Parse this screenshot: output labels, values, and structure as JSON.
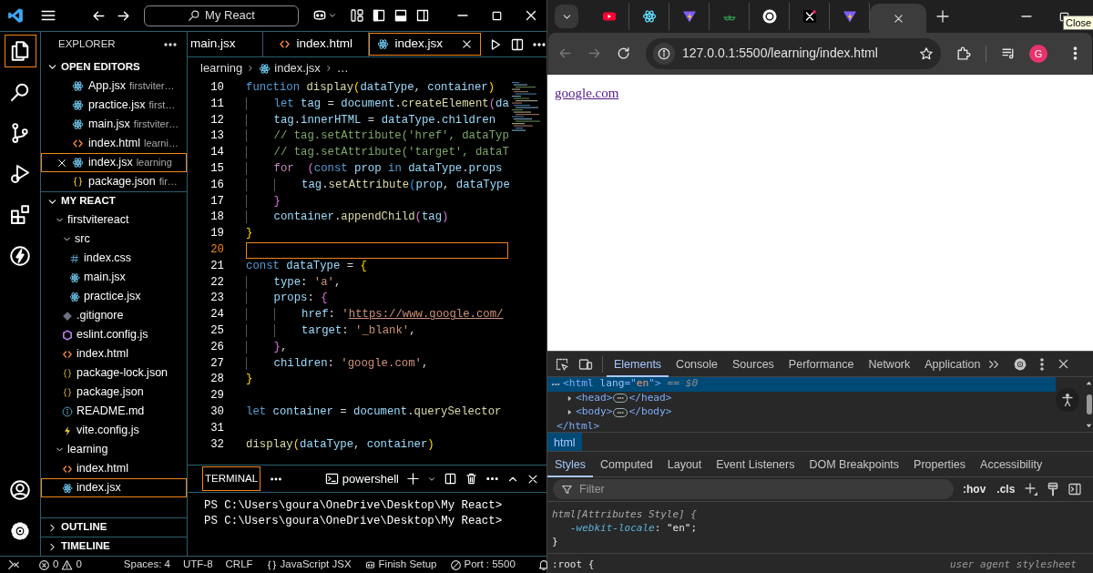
{
  "vscode": {
    "search": "My React",
    "activity": [
      {
        "kind": "explorer",
        "selected": true
      },
      {
        "kind": "search",
        "selected": false
      },
      {
        "kind": "source-control",
        "selected": false
      },
      {
        "kind": "run",
        "selected": false
      },
      {
        "kind": "extensions",
        "selected": false
      },
      {
        "kind": "lightning",
        "selected": false
      }
    ],
    "activity_bottom": [
      {
        "kind": "account"
      },
      {
        "kind": "settings"
      }
    ],
    "sidebar": {
      "title": "EXPLORER",
      "open_editors": {
        "title": "OPEN EDITORS",
        "expanded": true,
        "items": [
          {
            "kind": "react",
            "name": "App.jsx",
            "folder": "firstviter…",
            "selected": false
          },
          {
            "kind": "react",
            "name": "practice.jsx",
            "folder": "first…",
            "selected": false
          },
          {
            "kind": "react",
            "name": "main.jsx",
            "folder": "firstviter…",
            "selected": false
          },
          {
            "kind": "html",
            "name": "index.html",
            "folder": "learni…",
            "selected": false
          },
          {
            "kind": "react",
            "name": "index.jsx",
            "folder": "learning",
            "selected": true
          },
          {
            "kind": "json",
            "name": "package.json",
            "folder": "fir…",
            "selected": false
          }
        ]
      },
      "folder": {
        "title": "MY REACT",
        "expanded": true,
        "tree": [
          {
            "kind": "folder",
            "label": "firstvitereact",
            "expanded": true,
            "selected": false,
            "children": [
              {
                "kind": "folder",
                "label": "src",
                "expanded": true,
                "selected": false,
                "children": [
                  {
                    "kind": "css",
                    "label": "index.css",
                    "selected": false
                  },
                  {
                    "kind": "react",
                    "label": "main.jsx",
                    "selected": false
                  },
                  {
                    "kind": "react",
                    "label": "practice.jsx",
                    "selected": false
                  }
                ]
              },
              {
                "kind": "git",
                "label": ".gitignore",
                "selected": false
              },
              {
                "kind": "eslint",
                "label": "eslint.config.js",
                "selected": false
              },
              {
                "kind": "html",
                "label": "index.html",
                "selected": false
              },
              {
                "kind": "json",
                "label": "package-lock.json",
                "selected": false
              },
              {
                "kind": "json",
                "label": "package.json",
                "selected": false
              },
              {
                "kind": "info",
                "label": "README.md",
                "selected": false
              },
              {
                "kind": "vite",
                "label": "vite.config.js",
                "selected": false
              }
            ]
          },
          {
            "kind": "folder",
            "label": "learning",
            "expanded": true,
            "selected": false,
            "children": [
              {
                "kind": "html",
                "label": "index.html",
                "selected": false
              },
              {
                "kind": "react",
                "label": "index.jsx",
                "selected": true
              }
            ]
          }
        ]
      },
      "outline": {
        "title": "OUTLINE",
        "expanded": false
      },
      "timeline": {
        "title": "TIMELINE",
        "expanded": false
      }
    },
    "tabs": [
      {
        "label": "main.jsx",
        "selected": false
      },
      {
        "label": "index.html",
        "kind": "html",
        "selected": false
      },
      {
        "label": "index.jsx",
        "kind": "react",
        "selected": true
      }
    ],
    "breadcrumb": [
      {
        "label": "learning"
      },
      {
        "label": "index.jsx",
        "kind": "react"
      },
      {
        "label": "…"
      }
    ],
    "code": [
      {
        "number": "10",
        "current": false,
        "tokens": [
          {
            "kind": "kw",
            "text": "function"
          },
          {
            "kind": "fn",
            "text": " display"
          },
          {
            "kind": "b1",
            "text": "("
          },
          {
            "kind": "var",
            "text": "dataType"
          },
          {
            "kind": "op",
            "text": ", "
          },
          {
            "kind": "var",
            "text": "container"
          },
          {
            "kind": "b1",
            "text": ")"
          }
        ]
      },
      {
        "number": "11",
        "current": false,
        "tokens": [
          {
            "kind": "kw",
            "text": "    let"
          },
          {
            "kind": "var",
            "text": " tag"
          },
          {
            "kind": "op",
            "text": " = "
          },
          {
            "kind": "var",
            "text": "document"
          },
          {
            "kind": "op",
            "text": "."
          },
          {
            "kind": "fn",
            "text": "createElement"
          },
          {
            "kind": "b2",
            "text": "("
          },
          {
            "kind": "var",
            "text": "da"
          }
        ]
      },
      {
        "number": "12",
        "current": false,
        "tokens": [
          {
            "kind": "var",
            "text": "    tag"
          },
          {
            "kind": "op",
            "text": "."
          },
          {
            "kind": "var",
            "text": "innerHTML"
          },
          {
            "kind": "op",
            "text": " = "
          },
          {
            "kind": "var",
            "text": "dataType"
          },
          {
            "kind": "op",
            "text": "."
          },
          {
            "kind": "var",
            "text": "children"
          }
        ]
      },
      {
        "number": "13",
        "current": false,
        "tokens": [
          {
            "kind": "cm",
            "text": "    // tag.setAttribute('href', dataTyp"
          }
        ]
      },
      {
        "number": "14",
        "current": false,
        "tokens": [
          {
            "kind": "cm",
            "text": "    // tag.setAttribute('target', dataT"
          }
        ]
      },
      {
        "number": "15",
        "current": false,
        "tokens": [
          {
            "kind": "ctl",
            "text": "    for"
          },
          {
            "kind": "b2",
            "text": "  ("
          },
          {
            "kind": "kw",
            "text": "const"
          },
          {
            "kind": "var",
            "text": " prop "
          },
          {
            "kind": "kw",
            "text": "in"
          },
          {
            "kind": "var",
            "text": " dataType"
          },
          {
            "kind": "op",
            "text": "."
          },
          {
            "kind": "var",
            "text": "props"
          }
        ]
      },
      {
        "number": "16",
        "current": false,
        "tokens": [
          {
            "kind": "var",
            "text": "        tag"
          },
          {
            "kind": "op",
            "text": "."
          },
          {
            "kind": "fn",
            "text": "setAttribute"
          },
          {
            "kind": "b3",
            "text": "("
          },
          {
            "kind": "var",
            "text": "prop"
          },
          {
            "kind": "op",
            "text": ", "
          },
          {
            "kind": "var",
            "text": "dataType"
          }
        ]
      },
      {
        "number": "17",
        "current": false,
        "tokens": [
          {
            "kind": "b2",
            "text": "    }"
          }
        ]
      },
      {
        "number": "18",
        "current": false,
        "tokens": [
          {
            "kind": "var",
            "text": "    container"
          },
          {
            "kind": "op",
            "text": "."
          },
          {
            "kind": "fn",
            "text": "appendChild"
          },
          {
            "kind": "b2",
            "text": "("
          },
          {
            "kind": "var",
            "text": "tag"
          },
          {
            "kind": "b2",
            "text": ")"
          }
        ]
      },
      {
        "number": "19",
        "current": false,
        "tokens": [
          {
            "kind": "b1",
            "text": "}"
          }
        ]
      },
      {
        "number": "20",
        "current": true
      },
      {
        "number": "21",
        "current": false,
        "tokens": [
          {
            "kind": "kw",
            "text": "const"
          },
          {
            "kind": "var",
            "text": " dataType"
          },
          {
            "kind": "op",
            "text": " = "
          },
          {
            "kind": "b1",
            "text": "{"
          }
        ]
      },
      {
        "number": "22",
        "current": false,
        "tokens": [
          {
            "kind": "var",
            "text": "    type"
          },
          {
            "kind": "op",
            "text": ": "
          },
          {
            "kind": "str",
            "text": "'a'"
          },
          {
            "kind": "op",
            "text": ","
          }
        ]
      },
      {
        "number": "23",
        "current": false,
        "tokens": [
          {
            "kind": "var",
            "text": "    props"
          },
          {
            "kind": "op",
            "text": ": "
          },
          {
            "kind": "b2",
            "text": "{"
          }
        ]
      },
      {
        "number": "24",
        "current": false,
        "tokens": [
          {
            "kind": "var",
            "text": "        href"
          },
          {
            "kind": "op",
            "text": ": "
          },
          {
            "kind": "str",
            "text": "'"
          },
          {
            "kind": "url",
            "text": "https://www.google.com/"
          }
        ]
      },
      {
        "number": "25",
        "current": false,
        "tokens": [
          {
            "kind": "var",
            "text": "        target"
          },
          {
            "kind": "op",
            "text": ": "
          },
          {
            "kind": "str",
            "text": "'_blank'"
          },
          {
            "kind": "op",
            "text": ","
          }
        ]
      },
      {
        "number": "26",
        "current": false,
        "tokens": [
          {
            "kind": "b2",
            "text": "    }"
          },
          {
            "kind": "op",
            "text": ","
          }
        ]
      },
      {
        "number": "27",
        "current": false,
        "tokens": [
          {
            "kind": "var",
            "text": "    children"
          },
          {
            "kind": "op",
            "text": ": "
          },
          {
            "kind": "str",
            "text": "'google.com'"
          },
          {
            "kind": "op",
            "text": ","
          }
        ]
      },
      {
        "number": "28",
        "current": false,
        "tokens": [
          {
            "kind": "b1",
            "text": "}"
          }
        ]
      },
      {
        "number": "29",
        "current": false
      },
      {
        "number": "30",
        "current": false,
        "tokens": [
          {
            "kind": "kw",
            "text": "let"
          },
          {
            "kind": "var",
            "text": " container"
          },
          {
            "kind": "op",
            "text": " = "
          },
          {
            "kind": "var",
            "text": "document"
          },
          {
            "kind": "op",
            "text": "."
          },
          {
            "kind": "fn",
            "text": "querySelector"
          }
        ]
      },
      {
        "number": "31",
        "current": false
      },
      {
        "number": "32",
        "current": false,
        "tokens": [
          {
            "kind": "fn",
            "text": "display"
          },
          {
            "kind": "b1",
            "text": "("
          },
          {
            "kind": "var",
            "text": "dataType"
          },
          {
            "kind": "op",
            "text": ", "
          },
          {
            "kind": "var",
            "text": "container"
          },
          {
            "kind": "b1",
            "text": ")"
          }
        ]
      }
    ],
    "terminal": {
      "tabs": [
        {
          "label": "TERMINAL",
          "selected": true
        }
      ],
      "shell": "powershell",
      "lines": [
        "PS C:\\Users\\goura\\OneDrive\\Desktop\\My React>",
        "PS C:\\Users\\goura\\OneDrive\\Desktop\\My React>"
      ]
    },
    "status": {
      "errors": "0",
      "warnings": "0",
      "items": [
        "Spaces: 4",
        "UTF-8",
        "CRLF"
      ],
      "language": "JavaScript JSX",
      "setup": "Finish Setup",
      "port": "Port : 5500"
    }
  },
  "browser": {
    "tabs": [
      {
        "kind": "youtube",
        "selected": false
      },
      {
        "kind": "react",
        "selected": false
      },
      {
        "kind": "vite",
        "selected": false
      },
      {
        "kind": "gfg",
        "selected": false
      },
      {
        "kind": "openai",
        "selected": false
      },
      {
        "kind": "x",
        "selected": false
      },
      {
        "kind": "vite",
        "selected": false
      },
      {
        "kind": "blank",
        "selected": true
      }
    ],
    "tooltip": "Close",
    "back_enabled": false,
    "forward_enabled": false,
    "url": "127.0.0.1:5500/learning/index.html",
    "profile": "G",
    "page": {
      "link": "google.com"
    },
    "devtools": {
      "tabs": [
        {
          "label": "Elements",
          "selected": true
        },
        {
          "label": "Console",
          "selected": false
        },
        {
          "label": "Sources",
          "selected": false
        },
        {
          "label": "Performance",
          "selected": false
        },
        {
          "label": "Network",
          "selected": false
        },
        {
          "label": "Application",
          "selected": false
        }
      ],
      "dom": [
        {
          "selected": true,
          "expandable": false,
          "tokens": [
            {
              "kind": "tag",
              "text": "<html"
            },
            {
              "kind": "attr",
              "text": " lang"
            },
            {
              "kind": "tag",
              "text": "=\""
            },
            {
              "kind": "val",
              "text": "en"
            },
            {
              "kind": "tag",
              "text": "\">"
            },
            {
              "kind": "ref",
              "text": " == $0"
            }
          ]
        },
        {
          "selected": false,
          "expandable": true,
          "tokens": [
            {
              "kind": "tag",
              "text": "<head>"
            },
            {
              "kind": "collapsed"
            },
            {
              "kind": "tag",
              "text": "</head>"
            }
          ]
        },
        {
          "selected": false,
          "expandable": true,
          "tokens": [
            {
              "kind": "tag",
              "text": "<body>"
            },
            {
              "kind": "collapsed"
            },
            {
              "kind": "tag",
              "text": "</body>"
            }
          ]
        },
        {
          "selected": false,
          "expandable": false,
          "tokens": [
            {
              "kind": "tag",
              "text": "</html>"
            }
          ]
        }
      ],
      "breadcrumb": [
        {
          "label": "html",
          "selected": true
        }
      ],
      "style_tabs": [
        {
          "label": "Styles",
          "selected": true
        },
        {
          "label": "Computed",
          "selected": false
        },
        {
          "label": "Layout",
          "selected": false
        },
        {
          "label": "Event Listeners",
          "selected": false
        },
        {
          "label": "DOM Breakpoints",
          "selected": false
        },
        {
          "label": "Properties",
          "selected": false
        },
        {
          "label": "Accessibility",
          "selected": false
        }
      ],
      "filter": {
        "placeholder": "Filter",
        "buttons": [
          ":hov",
          ".cls"
        ]
      },
      "rules": [
        {
          "kind": "attr-selector",
          "text": "html[Attributes Style] {"
        },
        {
          "kind": "declaration",
          "property": "-webkit-locale",
          "value": ": \"en\";"
        },
        {
          "kind": "close",
          "text": "}"
        },
        {
          "kind": "selector",
          "text": ":root {",
          "source": "user agent stylesheet"
        }
      ]
    }
  }
}
